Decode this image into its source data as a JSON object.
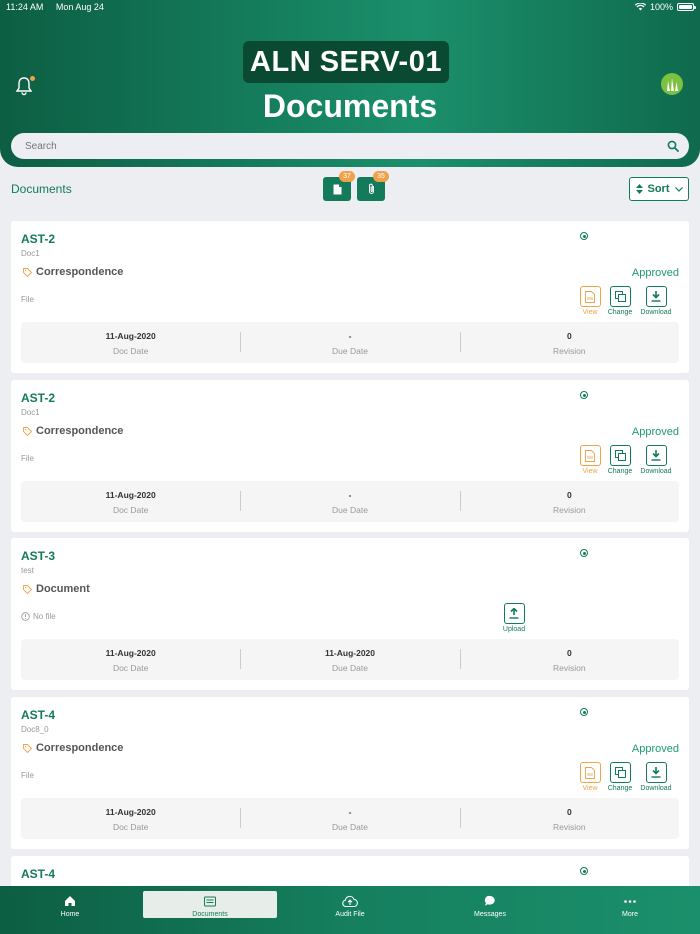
{
  "status_bar": {
    "time": "11:24 AM",
    "date": "Mon Aug 24",
    "battery": "100%"
  },
  "header": {
    "app_name": "ALN SERV-01",
    "title": "Documents"
  },
  "search": {
    "placeholder": "Search"
  },
  "toolbar": {
    "label": "Documents",
    "doc_filter_count": "37",
    "attach_filter_count": "35",
    "sort_label": "Sort"
  },
  "cards": [
    {
      "code": "AST-2",
      "sub": "Doc1",
      "category": "Correspondence",
      "status": "Approved",
      "file_label": "File",
      "doc_date": "11-Aug-2020",
      "due_date": "-",
      "revision": "0"
    },
    {
      "code": "AST-2",
      "sub": "Doc1",
      "category": "Correspondence",
      "status": "Approved",
      "file_label": "File",
      "doc_date": "11-Aug-2020",
      "due_date": "-",
      "revision": "0"
    },
    {
      "code": "AST-3",
      "sub": "test",
      "category": "Document",
      "status": "",
      "file_label": "No file",
      "doc_date": "11-Aug-2020",
      "due_date": "11-Aug-2020",
      "revision": "0"
    },
    {
      "code": "AST-4",
      "sub": "Doc8_0",
      "category": "Correspondence",
      "status": "Approved",
      "file_label": "File",
      "doc_date": "11-Aug-2020",
      "due_date": "-",
      "revision": "0"
    },
    {
      "code": "AST-4"
    }
  ],
  "labels": {
    "doc_date": "Doc Date",
    "due_date": "Due Date",
    "revision": "Revision",
    "view": "View",
    "change": "Change",
    "download": "Download",
    "upload": "Upload"
  },
  "nav": [
    {
      "label": "Home",
      "icon": "home-icon"
    },
    {
      "label": "Documents",
      "icon": "documents-icon",
      "active": true
    },
    {
      "label": "Audit File",
      "icon": "cloud-upload-icon"
    },
    {
      "label": "Messages",
      "icon": "chat-icon"
    },
    {
      "label": "More",
      "icon": "more-icon"
    }
  ],
  "colors": {
    "primary": "#137a5a",
    "accent": "#f0a24b",
    "background": "#eceef2"
  }
}
